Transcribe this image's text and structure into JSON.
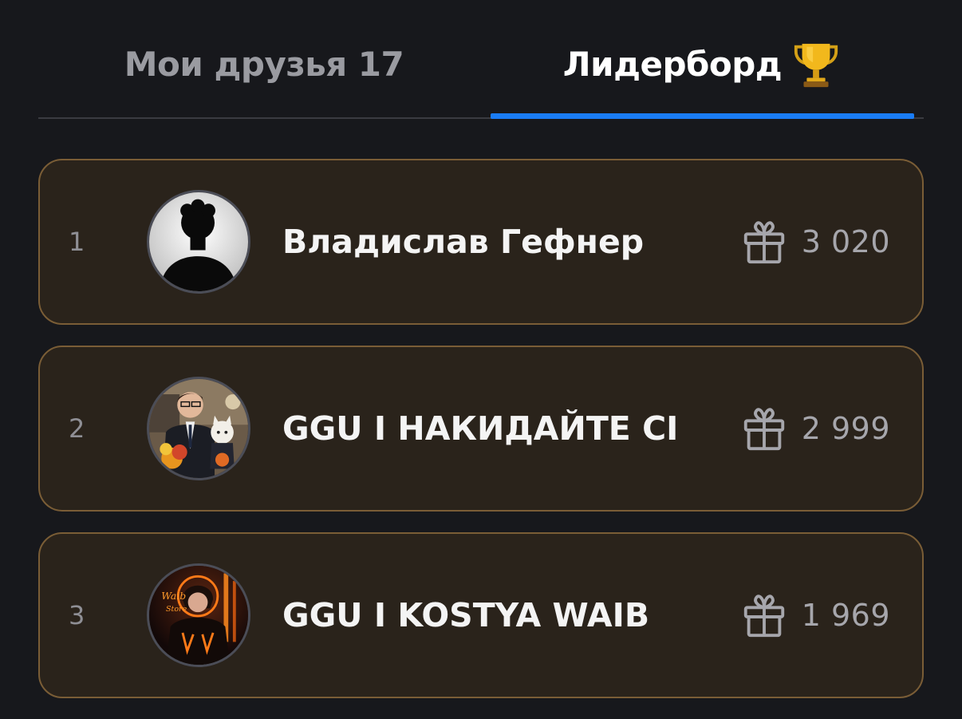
{
  "tabs": {
    "friends": {
      "label": "Мои друзья",
      "count": "17"
    },
    "leaderboard": {
      "label": "Лидерборд",
      "icon": "trophy-icon",
      "active": true
    }
  },
  "colors": {
    "background": "#17181c",
    "accent": "#1a7cf5",
    "card_background": "#2a231b",
    "card_border": "#7a5d36"
  },
  "leaderboard": {
    "rows": [
      {
        "rank": "1",
        "name": "Владислав Гефнер",
        "gifts": "3 020",
        "avatar": "silhouette-avatar",
        "gift_icon": "gift-icon"
      },
      {
        "rank": "2",
        "name": "GGU I НАКИДАЙТЕ СІ",
        "gifts": "2 999",
        "avatar": "photo-avatar",
        "gift_icon": "gift-icon"
      },
      {
        "rank": "3",
        "name": "GGU I KOSTYA WAIB",
        "gifts": "1 969",
        "avatar": "photo-avatar",
        "gift_icon": "gift-icon"
      }
    ]
  }
}
